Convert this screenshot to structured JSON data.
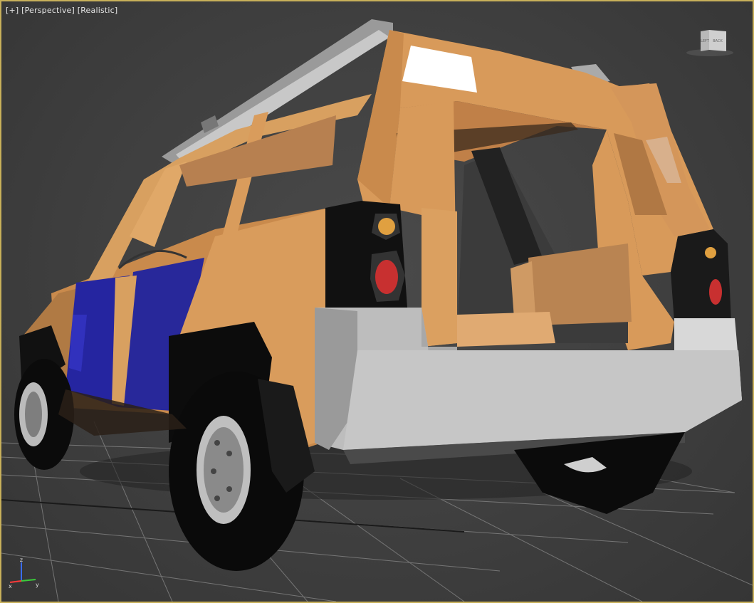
{
  "viewport": {
    "menu_plus": "[+]",
    "view_mode": "[Perspective]",
    "shading_mode": "[Realistic]"
  },
  "viewcube": {
    "left_face_label": "LEFT",
    "back_face_label": "BACK"
  },
  "axis_tripod": {
    "x_label": "x",
    "y_label": "y",
    "z_label": "z"
  },
  "colors": {
    "viewport_border": "#c8b05a",
    "body_orange": "#d89a5a",
    "door_blue": "#2a2a9a",
    "bumper_grey": "#bdbdbd",
    "taillight_red": "#c83030",
    "indicator_amber": "#e0a040",
    "grid": "#8a8a8a"
  }
}
